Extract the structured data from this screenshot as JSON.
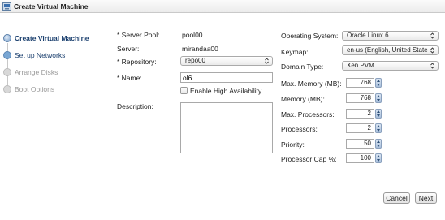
{
  "window": {
    "title": "Create Virtual Machine"
  },
  "steps": [
    {
      "label": "Create Virtual Machine",
      "state": "active"
    },
    {
      "label": "Set up Networks",
      "state": "done"
    },
    {
      "label": "Arrange Disks",
      "state": "disabled"
    },
    {
      "label": "Boot Options",
      "state": "disabled"
    }
  ],
  "form": {
    "server_pool_label": "* Server Pool:",
    "server_pool_value": "pool00",
    "server_label": "Server:",
    "server_value": "mirandaa00",
    "repository_label": "* Repository:",
    "repository_value": "repo00",
    "name_label": "* Name:",
    "name_value": "ol6",
    "ha_label": "Enable High Availability",
    "description_label": "Description:",
    "description_value": "",
    "os_label": "Operating System:",
    "os_value": "Oracle Linux 6",
    "keymap_label": "Keymap:",
    "keymap_value": "en-us (English, United State",
    "domain_type_label": "Domain Type:",
    "domain_type_value": "Xen PVM",
    "max_memory_label": "Max. Memory (MB):",
    "max_memory_value": "768",
    "memory_label": "Memory (MB):",
    "memory_value": "768",
    "max_processors_label": "Max. Processors:",
    "max_processors_value": "2",
    "processors_label": "Processors:",
    "processors_value": "2",
    "priority_label": "Priority:",
    "priority_value": "50",
    "processor_cap_label": "Processor Cap %:",
    "processor_cap_value": "100"
  },
  "buttons": {
    "cancel": "Cancel",
    "next": "Next"
  },
  "icons": {
    "window": "vm-window-icon",
    "select_arrows": "updown-chevron-icon",
    "spinner": "spinner-arrows-icon"
  }
}
